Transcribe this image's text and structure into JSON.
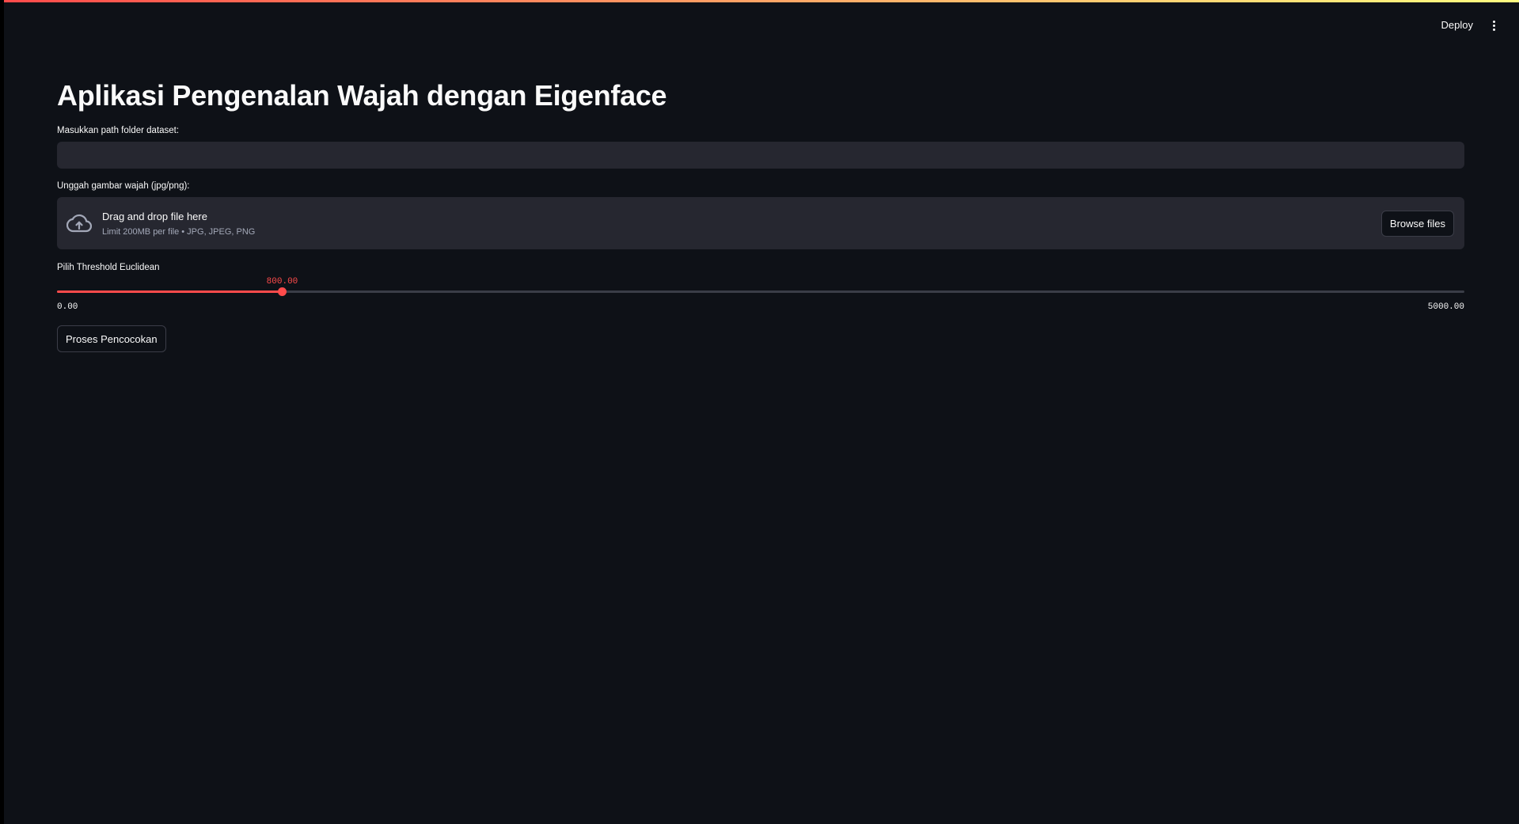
{
  "header": {
    "deploy_label": "Deploy",
    "menu_icon": "vertical-ellipsis-icon"
  },
  "main": {
    "title": "Aplikasi Pengenalan Wajah dengan Eigenface",
    "dataset_input": {
      "label": "Masukkan path folder dataset:",
      "value": "",
      "placeholder": ""
    },
    "uploader": {
      "label": "Unggah gambar wajah (jpg/png):",
      "icon": "cloud-upload-icon",
      "title": "Drag and drop file here",
      "subtitle": "Limit 200MB per file • JPG, JPEG, PNG",
      "browse_label": "Browse files"
    },
    "slider": {
      "label": "Pilih Threshold Euclidean",
      "value": 800.0,
      "value_text": "800.00",
      "min": 0.0,
      "max": 5000.0,
      "min_text": "0.00",
      "max_text": "5000.00"
    },
    "process_button_label": "Proses Pencocokan"
  },
  "colors": {
    "background": "#0e1117",
    "surface": "#262730",
    "accent": "#ff4b4b",
    "text": "#fafafa",
    "muted_text": "#a3a8b8"
  }
}
